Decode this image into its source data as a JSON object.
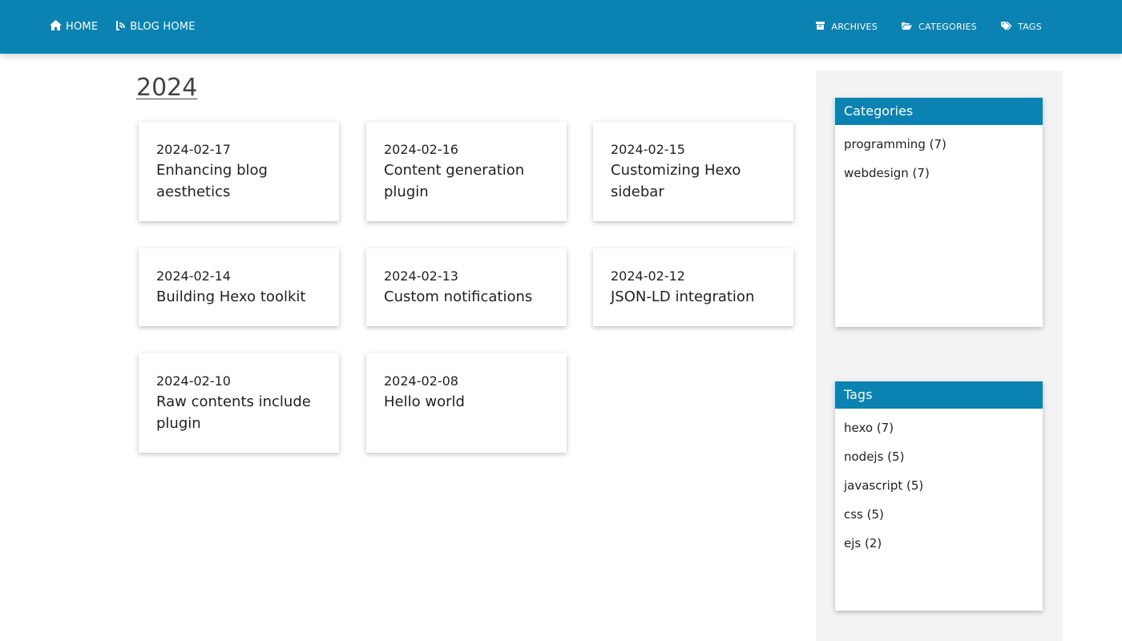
{
  "nav": {
    "home": "HOME",
    "blog_home": "BLOG HOME",
    "archives": "ARCHIVES",
    "categories": "CATEGORIES",
    "tags": "TAGS"
  },
  "year": "2024",
  "posts": [
    {
      "date": "2024-02-17",
      "title": "Enhancing blog aesthetics"
    },
    {
      "date": "2024-02-16",
      "title": "Content generation plugin"
    },
    {
      "date": "2024-02-15",
      "title": "Customizing Hexo sidebar"
    },
    {
      "date": "2024-02-14",
      "title": "Building Hexo toolkit"
    },
    {
      "date": "2024-02-13",
      "title": "Custom notifications"
    },
    {
      "date": "2024-02-12",
      "title": "JSON-LD integration"
    },
    {
      "date": "2024-02-10",
      "title": "Raw contents include plugin"
    },
    {
      "date": "2024-02-08",
      "title": "Hello world"
    }
  ],
  "sidebar": {
    "categories": {
      "title": "Categories",
      "items": [
        "programming (7)",
        "webdesign (7)"
      ]
    },
    "tags": {
      "title": "Tags",
      "items": [
        "hexo (7)",
        "nodejs (5)",
        "javascript (5)",
        "css (5)",
        "ejs (2)"
      ]
    }
  },
  "colors": {
    "accent": "#0a83b3",
    "sidebar_bg": "#f3f3f3"
  },
  "icons": {
    "home": "home-icon",
    "blog_home": "blog-icon",
    "archives": "archive-box-icon",
    "categories": "folder-open-icon",
    "tags": "tags-icon"
  }
}
